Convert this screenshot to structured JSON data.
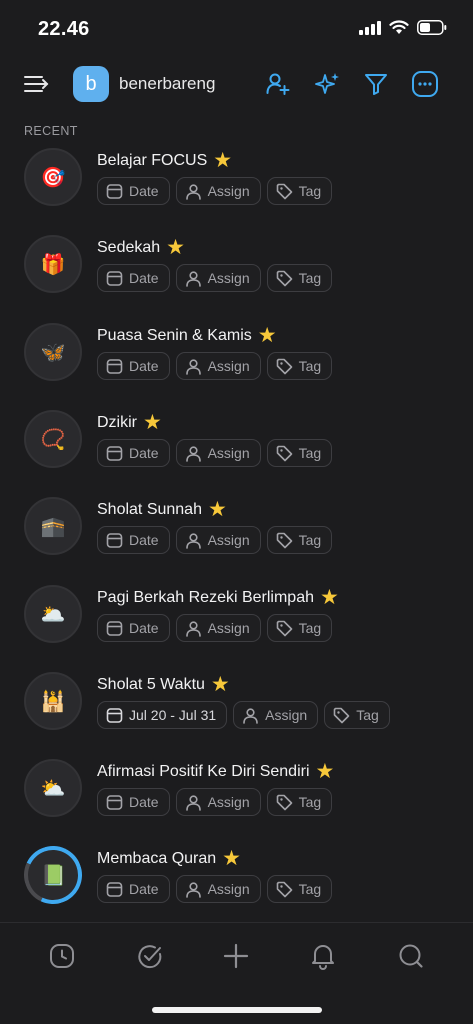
{
  "status_bar": {
    "time": "22.46"
  },
  "header": {
    "avatar_letter": "b",
    "workspace_name": "benerbareng"
  },
  "section": {
    "label": "RECENT"
  },
  "chip_labels": {
    "date": "Date",
    "assign": "Assign",
    "tag": "Tag"
  },
  "tasks": [
    {
      "title": "Belajar FOCUS",
      "emoji": "🎯",
      "date": "Date",
      "starred": true
    },
    {
      "title": "Sedekah",
      "emoji": "🎁",
      "date": "Date",
      "starred": true
    },
    {
      "title": "Puasa Senin & Kamis",
      "emoji": "🦋",
      "date": "Date",
      "starred": true
    },
    {
      "title": "Dzikir",
      "emoji": "📿",
      "date": "Date",
      "starred": true
    },
    {
      "title": "Sholat Sunnah",
      "emoji": "🕋",
      "date": "Date",
      "starred": true
    },
    {
      "title": "Pagi Berkah Rezeki Berlimpah",
      "emoji": "🌥️",
      "date": "Date",
      "starred": true
    },
    {
      "title": "Sholat 5 Waktu",
      "emoji": "🕌",
      "date": "Jul 20 - Jul 31",
      "starred": true
    },
    {
      "title": "Afirmasi Positif Ke Diri Sendiri",
      "emoji": "⛅",
      "date": "Date",
      "starred": true
    },
    {
      "title": "Membaca Quran",
      "emoji": "📗",
      "date": "Date",
      "starred": true,
      "progress": 0.8
    }
  ],
  "colors": {
    "accent": "#3fa9f0",
    "star": "#f7c83a",
    "avatar": "#5fb0ee",
    "background": "#1c1c1e"
  },
  "nav": [
    "clock-icon",
    "check-circle-icon",
    "plus-icon",
    "bell-icon",
    "search-icon"
  ]
}
